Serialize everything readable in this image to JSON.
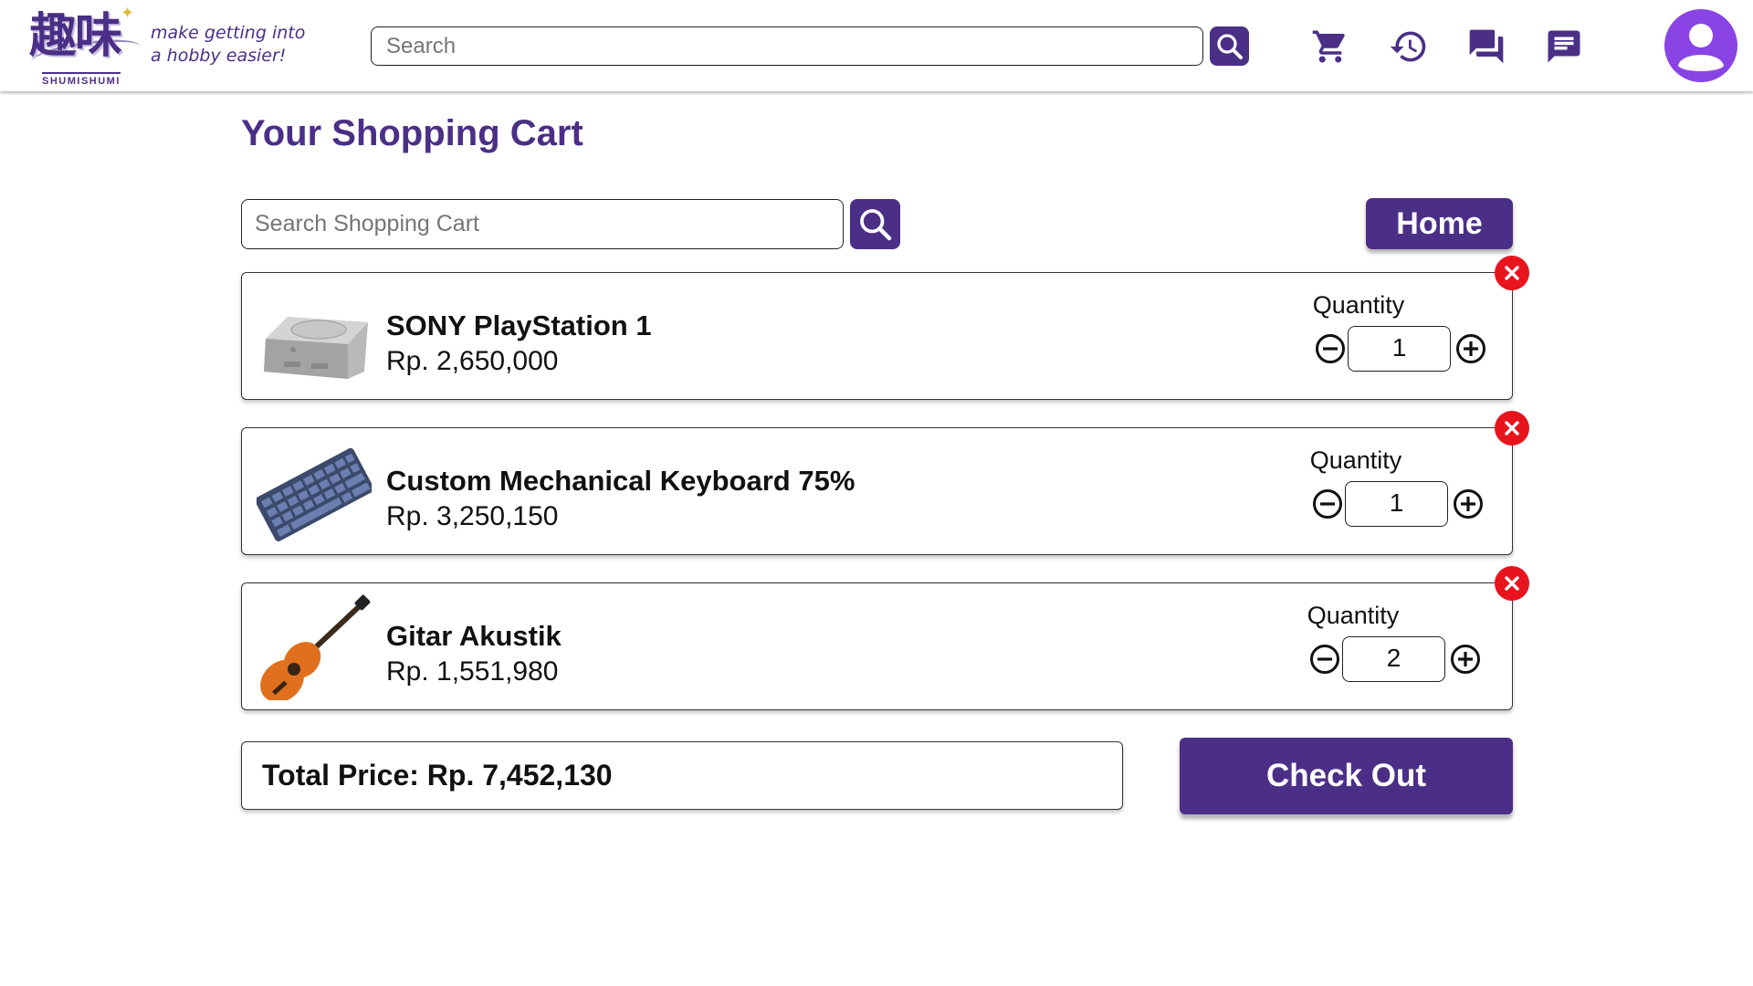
{
  "header": {
    "logo_kanji": "趣味",
    "logo_text": "SHUMISHUMI",
    "tagline_line1": "make getting into",
    "tagline_line2": "a hobby easier!",
    "search_placeholder": "Search",
    "icons": [
      "search-icon",
      "cart-icon",
      "history-icon",
      "forum-icon",
      "chat-icon",
      "user-avatar-icon"
    ]
  },
  "page": {
    "title": "Your Shopping Cart",
    "search_placeholder": "Search Shopping Cart",
    "home_label": "Home"
  },
  "cart": {
    "quantity_label": "Quantity",
    "items": [
      {
        "name": "SONY PlayStation 1",
        "price": "Rp. 2,650,000",
        "quantity": "1",
        "thumb_icon": "console-icon"
      },
      {
        "name": "Custom Mechanical Keyboard 75%",
        "price": "Rp. 3,250,150",
        "quantity": "1",
        "thumb_icon": "keyboard-icon"
      },
      {
        "name": "Gitar Akustik",
        "price": "Rp. 1,551,980",
        "quantity": "2",
        "thumb_icon": "guitar-icon"
      }
    ],
    "total_label": "Total Price: Rp. 7,452,130",
    "checkout_label": "Check Out"
  },
  "colors": {
    "brand": "#4b2f86",
    "avatar": "#8a44e6",
    "remove": "#e8141d"
  }
}
